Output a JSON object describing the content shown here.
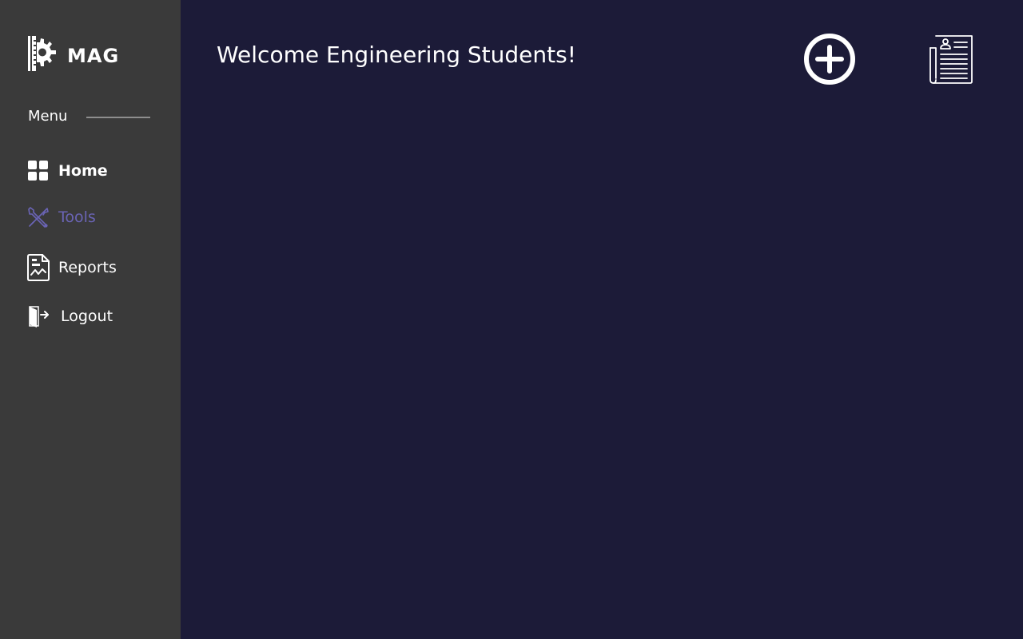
{
  "brand": {
    "name": "MAG",
    "icon": "ruler-gear-logo-icon"
  },
  "sidebar": {
    "menu_heading": "Menu",
    "items": [
      {
        "label": "Home",
        "icon": "dashboard-grid-icon",
        "state": "default"
      },
      {
        "label": "Tools",
        "icon": "tools-crossed-icon",
        "state": "active"
      },
      {
        "label": "Reports",
        "icon": "report-chart-icon",
        "state": "default"
      },
      {
        "label": "Logout",
        "icon": "door-exit-icon",
        "state": "default"
      }
    ]
  },
  "main": {
    "welcome": "Welcome Engineering Students!",
    "actions": [
      {
        "icon": "plus-circle-icon"
      },
      {
        "icon": "newspaper-profile-icon"
      }
    ]
  },
  "colors": {
    "sidebar_bg": "#3a3a3a",
    "main_bg": "#1c1b38",
    "active_item": "#6a64b5",
    "text": "#ffffff",
    "divider": "#8d8d8d"
  }
}
